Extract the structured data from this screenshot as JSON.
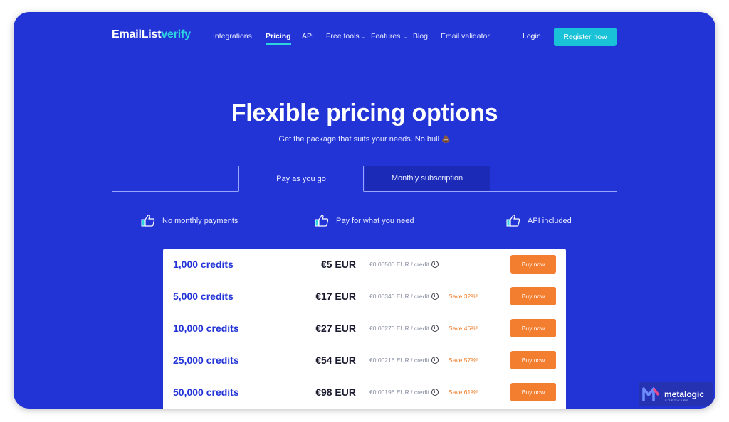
{
  "brand": {
    "logo_part1": "EmailList",
    "logo_part2": "verify"
  },
  "nav": {
    "links": [
      {
        "label": "Integrations"
      },
      {
        "label": "Pricing"
      },
      {
        "label": "API"
      },
      {
        "label": "Free tools"
      },
      {
        "label": "Features"
      },
      {
        "label": "Blog"
      },
      {
        "label": "Email validator"
      }
    ],
    "login": "Login",
    "register": "Register now"
  },
  "hero": {
    "title": "Flexible pricing options",
    "subtitle": "Get the package that suits your needs.  No bull",
    "emoji": "💩"
  },
  "tabs": [
    {
      "label": "Pay as you go",
      "active": true
    },
    {
      "label": "Monthly subscription",
      "active": false
    }
  ],
  "features": [
    {
      "label": "No monthly payments",
      "icon": "thumbs-up-icon"
    },
    {
      "label": "Pay for what you need",
      "icon": "thumbs-up-icon"
    },
    {
      "label": "API included",
      "icon": "thumbs-up-icon"
    }
  ],
  "pricing": {
    "rows": [
      {
        "credits": "1,000 credits",
        "price": "€5 EUR",
        "per_credit": "€0.00500 EUR / credit",
        "save": "",
        "button": "Buy now"
      },
      {
        "credits": "5,000 credits",
        "price": "€17 EUR",
        "per_credit": "€0.00340 EUR / credit",
        "save": "Save 32%!",
        "button": "Buy now"
      },
      {
        "credits": "10,000 credits",
        "price": "€27 EUR",
        "per_credit": "€0.00270 EUR / credit",
        "save": "Save 46%!",
        "button": "Buy now"
      },
      {
        "credits": "25,000 credits",
        "price": "€54 EUR",
        "per_credit": "€0.00216 EUR / credit",
        "save": "Save 57%!",
        "button": "Buy now"
      },
      {
        "credits": "50,000 credits",
        "price": "€98 EUR",
        "per_credit": "€0.00196 EUR / credit",
        "save": "Save 61%!",
        "button": "Buy now"
      }
    ]
  },
  "watermark": {
    "name": "metalogic",
    "tagline": "SOFTWARE"
  },
  "colors": {
    "background": "#2234d6",
    "accent": "#19c2d6",
    "buy_button": "#f37e30",
    "save_text": "#f07a24"
  }
}
